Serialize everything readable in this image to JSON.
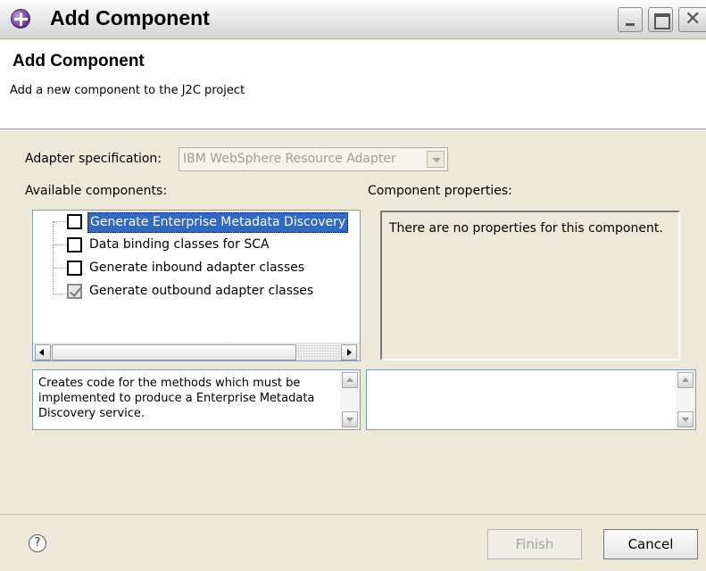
{
  "window": {
    "title": "Add Component"
  },
  "header": {
    "title": "Add Component",
    "description": "Add a new component to the J2C project"
  },
  "adapter": {
    "label": "Adapter specification:",
    "value": "IBM WebSphere Resource Adapter"
  },
  "available": {
    "label": "Available components:",
    "items": [
      {
        "label": "Generate Enterprise Metadata Discovery",
        "checked": false,
        "selected": true
      },
      {
        "label": "Data binding classes for SCA",
        "checked": false,
        "selected": false
      },
      {
        "label": "Generate inbound adapter classes",
        "checked": false,
        "selected": false
      },
      {
        "label": "Generate outbound adapter classes",
        "checked": true,
        "selected": false
      }
    ]
  },
  "properties": {
    "label": "Component properties:",
    "empty_text": "There are no properties for this component."
  },
  "description_text": "Creates code for the methods which must be implemented to produce a Enterprise Metadata Discovery service.",
  "footer": {
    "help_symbol": "?",
    "finish_label": "Finish",
    "cancel_label": "Cancel"
  }
}
